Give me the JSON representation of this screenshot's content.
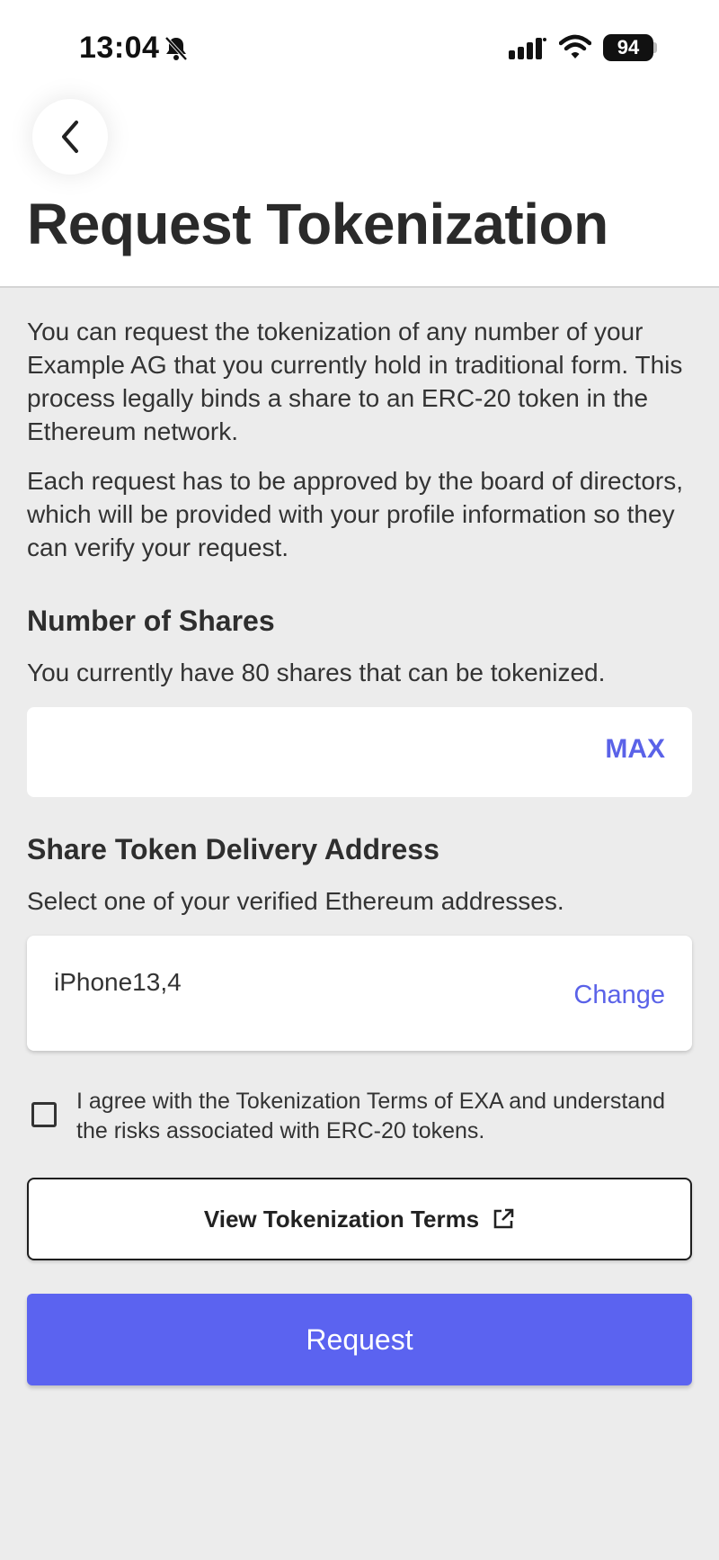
{
  "status_bar": {
    "time": "13:04",
    "battery": "94",
    "icons": [
      "bell-slash-icon",
      "signal-icon",
      "wifi-icon",
      "battery-icon"
    ]
  },
  "header": {
    "back_icon": "chevron-left-icon",
    "title": "Request Tokenization"
  },
  "intro": {
    "paragraph_1": "You can request the tokenization of any number of your Example AG that you currently hold in traditional form. This process legally binds a share to an ERC-20 token in the Ethereum network.",
    "paragraph_2": "Each request has to be approved by the board of directors, which will be provided with your profile information so they can verify your request."
  },
  "shares": {
    "title": "Number of Shares",
    "subtitle": "You currently have 80 shares that can be tokenized.",
    "input_value": "",
    "max_label": "MAX"
  },
  "delivery": {
    "title": "Share Token Delivery Address",
    "subtitle": "Select one of your verified Ethereum addresses.",
    "address_name": "iPhone13,4",
    "change_label": "Change"
  },
  "agreement": {
    "checked": false,
    "text": "I agree with the Tokenization Terms of EXA and understand the risks associated with ERC-20 tokens."
  },
  "buttons": {
    "terms_label": "View Tokenization Terms",
    "terms_icon": "external-link-icon",
    "request_label": "Request"
  },
  "colors": {
    "accent": "#5a62e8",
    "primary_button": "#5b63f0",
    "background": "#ececec",
    "header_background": "#ffffff"
  }
}
